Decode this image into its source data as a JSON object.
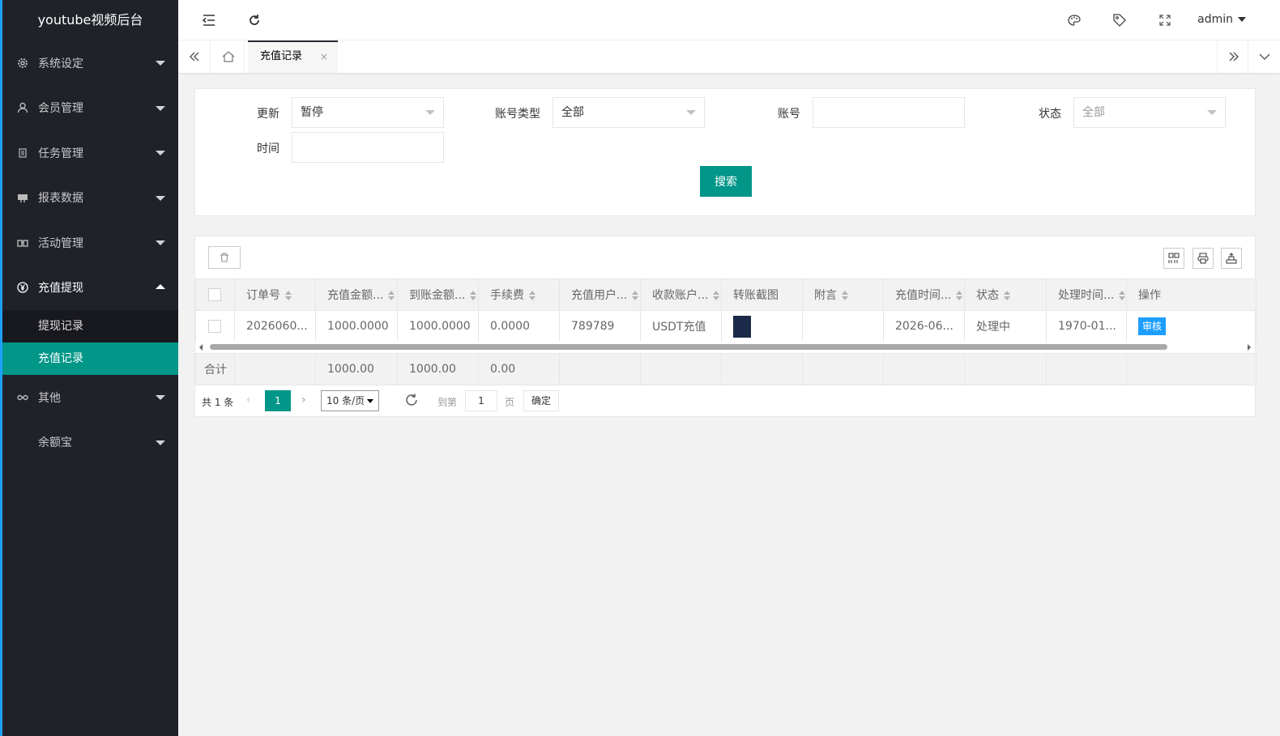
{
  "app": {
    "title": "youtube视频后台"
  },
  "sidebar": {
    "items": [
      {
        "label": "系统设定",
        "icon": "gear-icon"
      },
      {
        "label": "会员管理",
        "icon": "user-icon"
      },
      {
        "label": "任务管理",
        "icon": "file-icon"
      },
      {
        "label": "报表数据",
        "icon": "chart-icon"
      },
      {
        "label": "活动管理",
        "icon": "activity-icon"
      },
      {
        "label": "充值提现",
        "icon": "yen-icon",
        "sub": [
          {
            "label": "提现记录"
          },
          {
            "label": "充值记录"
          }
        ]
      },
      {
        "label": "其他",
        "icon": "infinity-icon"
      },
      {
        "label": "余额宝",
        "icon": ""
      }
    ]
  },
  "header": {
    "user": "admin"
  },
  "tabs": {
    "active": "充值记录",
    "close": "×"
  },
  "filters": {
    "update_label": "更新",
    "update_value": "暂停",
    "account_type_label": "账号类型",
    "account_type_value": "全部",
    "account_label": "账号",
    "account_value": "",
    "status_label": "状态",
    "status_value": "全部",
    "time_label": "时间",
    "time_value": "",
    "search_btn": "搜索"
  },
  "table": {
    "columns": [
      "订单号",
      "充值金额...",
      "到账金额...",
      "手续费",
      "充值用户...",
      "收款账户...",
      "转账截图",
      "附言",
      "充值时间...",
      "状态",
      "处理时间...",
      "操作"
    ],
    "rows": [
      {
        "order": "2026060...",
        "amount": "1000.0000",
        "received": "1000.0000",
        "fee": "0.0000",
        "user": "789789",
        "account": "USDT充值",
        "note": "",
        "time": "2026-06...",
        "status": "处理中",
        "processed": "1970-01...",
        "action": "审核"
      }
    ],
    "total": {
      "label": "合计",
      "amount": "1000.00",
      "received": "1000.00",
      "fee": "0.00"
    }
  },
  "pagination": {
    "total": "共 1 条",
    "page": "1",
    "per_page": "10 条/页",
    "goto": "到第",
    "goto_value": "1",
    "page_unit": "页",
    "confirm": "确定"
  }
}
